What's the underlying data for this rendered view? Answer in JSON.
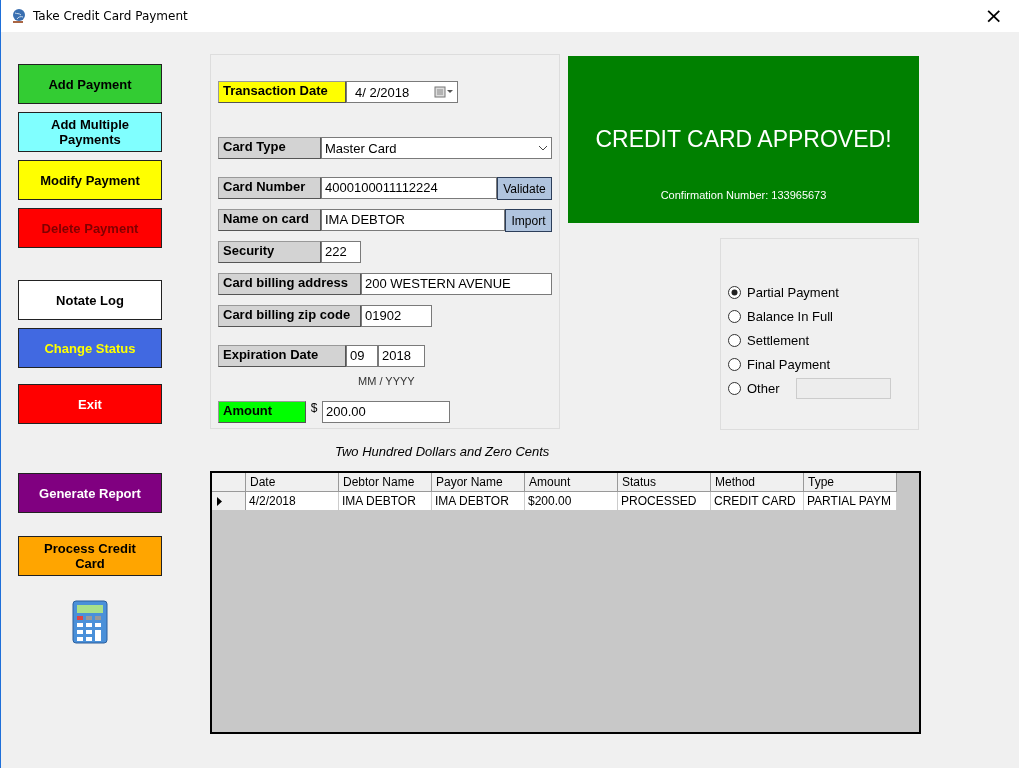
{
  "window": {
    "title": "Take Credit Card Payment",
    "close": "×"
  },
  "left_buttons": [
    {
      "label": {
        "text": "Add Payment",
        "color": "#000000"
      },
      "color": "#33cc33"
    },
    {
      "label": {
        "text": "Add Multiple Payments",
        "color": "#000000"
      },
      "color": "#80ffff"
    },
    {
      "label": {
        "text": "Modify Payment",
        "color": "#000000"
      },
      "color": "#ffff00"
    },
    {
      "label": {
        "text": "Delete Payment",
        "color": "#800000"
      },
      "color": "#ff0000"
    },
    {
      "label": {
        "text": "Notate Log",
        "color": "#000000"
      },
      "color": "#ffffff"
    },
    {
      "label": {
        "text": "Change Status",
        "color": "#ffff00"
      },
      "color": "#4169e1"
    },
    {
      "label": {
        "text": "Exit",
        "color": "#ffffff"
      },
      "color": "#ff0000"
    },
    {
      "label": {
        "text": "Generate Report",
        "color": "#ffffff"
      },
      "color": "#800080"
    },
    {
      "label": {
        "text": "Process Credit Card",
        "color": "#000000"
      },
      "color": "#ffa500"
    }
  ],
  "form": {
    "fields": [
      {
        "kind": "date",
        "label": "Transaction Date",
        "color": "#ffff00",
        "value": "4/  2/2018"
      },
      {
        "kind": "select",
        "label": "Card Type",
        "color": "#d3d3d3",
        "value": "Master Card"
      },
      {
        "kind": "button",
        "label": "Card Number",
        "color": "#d3d3d3",
        "value": "4000100011112224",
        "button": "Validate"
      },
      {
        "kind": "button",
        "label": "Name on card",
        "color": "#d3d3d3",
        "value": "IMA DEBTOR",
        "button": "Import"
      },
      {
        "kind": "text",
        "label": "Security",
        "color": "#d3d3d3",
        "value": "222"
      },
      {
        "kind": "text",
        "label": "Card billing address",
        "color": "#d3d3d3",
        "value": "200 WESTERN AVENUE"
      },
      {
        "kind": "text",
        "label": "Card billing zip code",
        "color": "#d3d3d3",
        "value": "01902"
      },
      {
        "kind": "expiry",
        "label": "Expiration Date",
        "color": "#d3d3d3",
        "month": "09",
        "year": "2018",
        "hint": "MM / YYYY"
      },
      {
        "kind": "currency",
        "label": "Amount",
        "color": "#00ff00",
        "prefix": "$",
        "value": "200.00"
      }
    ]
  },
  "approval": {
    "title": "CREDIT CARD APPROVED!",
    "confirmation": "Confirmation Number: 133965673"
  },
  "payment_types": [
    {
      "label": "Partial Payment",
      "selected": true,
      "kind": "plain"
    },
    {
      "label": "Balance In Full",
      "selected": false,
      "kind": "plain"
    },
    {
      "label": "Settlement",
      "selected": false,
      "kind": "plain"
    },
    {
      "label": "Final Payment",
      "selected": false,
      "kind": "plain"
    },
    {
      "label": "Other",
      "selected": false,
      "kind": "with_field"
    }
  ],
  "amount_in_words": "Two Hundred  Dollars and Zero Cents",
  "table": {
    "columns": [
      "Date",
      "Debtor Name",
      "Payor Name",
      "Amount",
      "Status",
      "Method",
      "Type"
    ],
    "rows": [
      {
        "selected": true,
        "cells": [
          "4/2/2018",
          "IMA DEBTOR",
          "IMA DEBTOR",
          "$200.00",
          "PROCESSED",
          "CREDIT CARD",
          "PARTIAL PAYM"
        ]
      }
    ]
  }
}
